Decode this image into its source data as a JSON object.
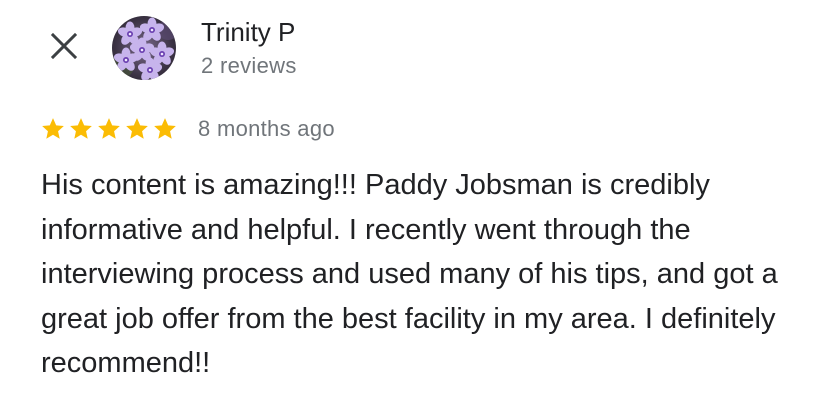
{
  "review": {
    "reviewer_name": "Trinity P",
    "review_count": "2 reviews",
    "rating": 5,
    "rating_max": 5,
    "date": "8 months ago",
    "text": "His content is amazing!!! Paddy Jobsman is credibly informative and helpful. I recently went through the interviewing process and used many of his tips, and got a great job offer from the best facility in my area. I definitely recommend!!"
  },
  "icons": {
    "close": "close-icon",
    "star": "star-icon",
    "avatar": "purple-flowers-photo"
  },
  "colors": {
    "star": "#fbbc04",
    "primary_text": "#202124",
    "secondary_text": "#70757a",
    "close_icon": "#3c4043"
  }
}
